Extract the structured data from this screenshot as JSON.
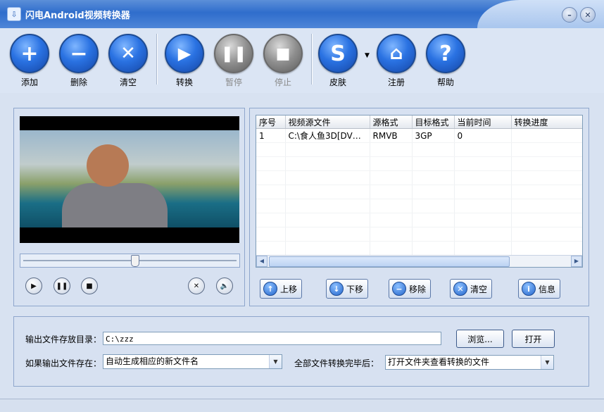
{
  "window": {
    "title": "闪电Android视频转换器",
    "minimize_icon": "minimize-icon",
    "close_icon": "close-icon"
  },
  "toolbar": {
    "add": "添加",
    "delete": "删除",
    "clear": "清空",
    "convert": "转换",
    "pause": "暂停",
    "stop": "停止",
    "skin": "皮肤",
    "register": "注册",
    "help": "帮助"
  },
  "player": {
    "seek_progress": 0.52
  },
  "table": {
    "columns": [
      "序号",
      "视频源文件",
      "源格式",
      "目标格式",
      "当前时间",
      "转换进度"
    ],
    "rows": [
      {
        "index": "1",
        "source": "C:\\食人鱼3D[DVD中...",
        "src_format": "RMVB",
        "target_format": "3GP",
        "current_time": "0",
        "progress": ""
      }
    ]
  },
  "list_buttons": {
    "up": "上移",
    "down": "下移",
    "remove": "移除",
    "clear": "清空",
    "info": "信息"
  },
  "settings": {
    "output_dir_label": "输出文件存放目录：",
    "output_dir": "C:\\zzz",
    "browse": "浏览...",
    "open": "打开",
    "exists_label": "如果输出文件存在：",
    "exists_value": "自动生成相应的新文件名",
    "after_label": "全部文件转换完毕后：",
    "after_value": "打开文件夹查看转换的文件"
  }
}
